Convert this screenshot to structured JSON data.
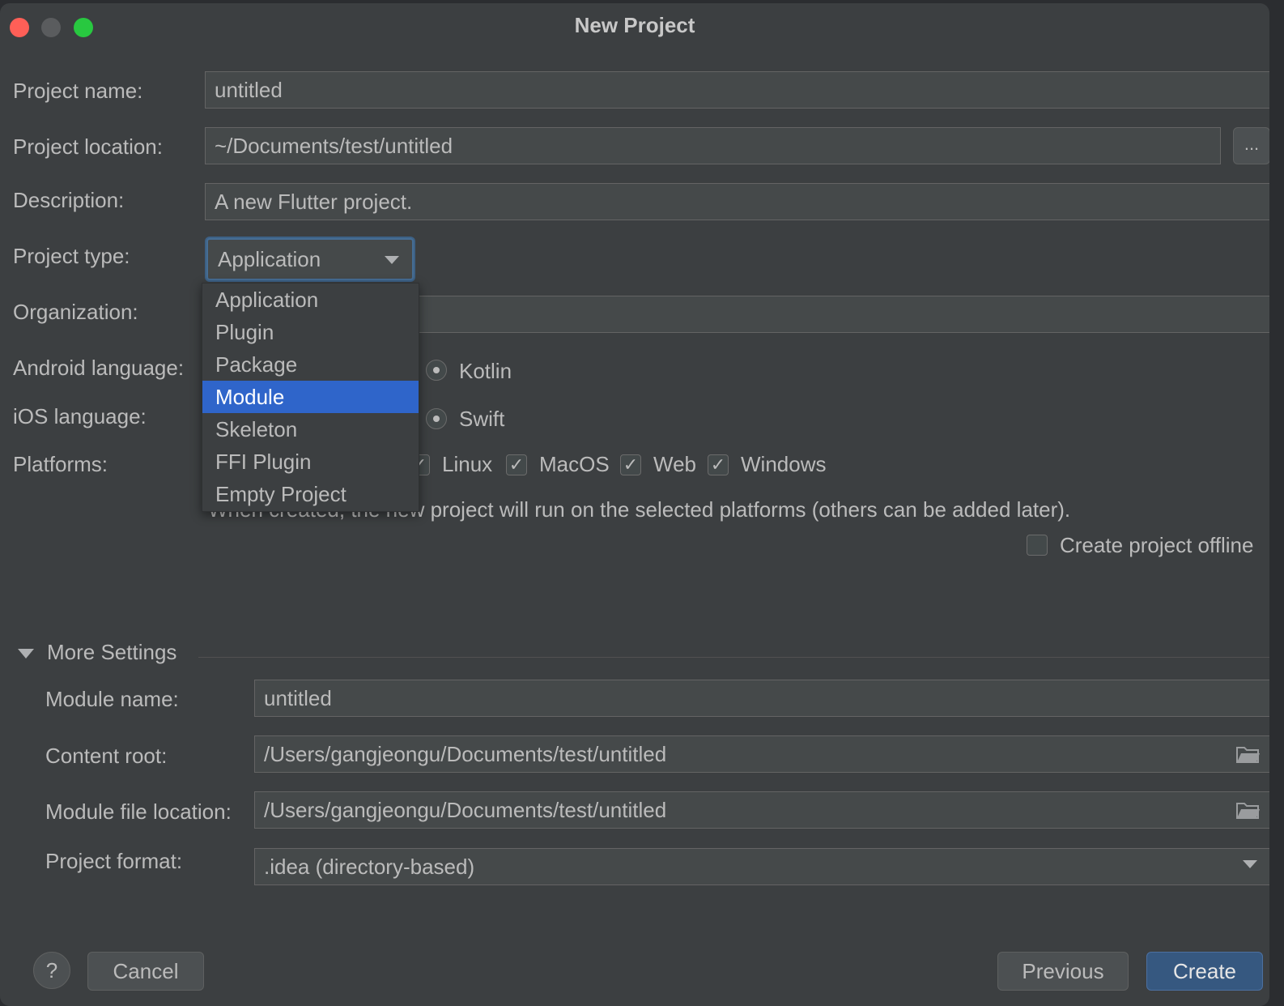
{
  "window": {
    "title": "New Project"
  },
  "form": {
    "project_name_label": "Project name:",
    "project_name_value": "untitled",
    "project_location_label": "Project location:",
    "project_location_value": "~/Documents/test/untitled",
    "browse_label": "...",
    "description_label": "Description:",
    "description_value": "A new Flutter project.",
    "project_type_label": "Project type:",
    "project_type_value": "Application",
    "project_type_options": [
      "Application",
      "Plugin",
      "Package",
      "Module",
      "Skeleton",
      "FFI Plugin",
      "Empty Project"
    ],
    "project_type_highlighted": "Module",
    "organization_label": "Organization:",
    "android_language_label": "Android language:",
    "android_language_value": "Kotlin",
    "ios_language_label": "iOS language:",
    "ios_language_value": "Swift",
    "platforms_label": "Platforms:",
    "platforms": [
      {
        "label": "Linux",
        "checked": true
      },
      {
        "label": "MacOS",
        "checked": true
      },
      {
        "label": "Web",
        "checked": true
      },
      {
        "label": "Windows",
        "checked": true
      }
    ],
    "platforms_note": "When created, the new project will run on the selected platforms (others can be added later).",
    "offline_label": "Create project offline",
    "offline_checked": false
  },
  "more_settings": {
    "header": "More Settings",
    "expanded": true,
    "module_name_label": "Module name:",
    "module_name_value": "untitled",
    "content_root_label": "Content root:",
    "content_root_value": "/Users/gangjeongu/Documents/test/untitled",
    "module_file_label": "Module file location:",
    "module_file_value": "/Users/gangjeongu/Documents/test/untitled",
    "project_format_label": "Project format:",
    "project_format_value": ".idea (directory-based)"
  },
  "footer": {
    "help_label": "?",
    "cancel_label": "Cancel",
    "previous_label": "Previous",
    "create_label": "Create"
  },
  "colors": {
    "background": "#3c3f41",
    "field_bg": "#45494a",
    "selection": "#2f65ca",
    "primary_button": "#365880"
  }
}
